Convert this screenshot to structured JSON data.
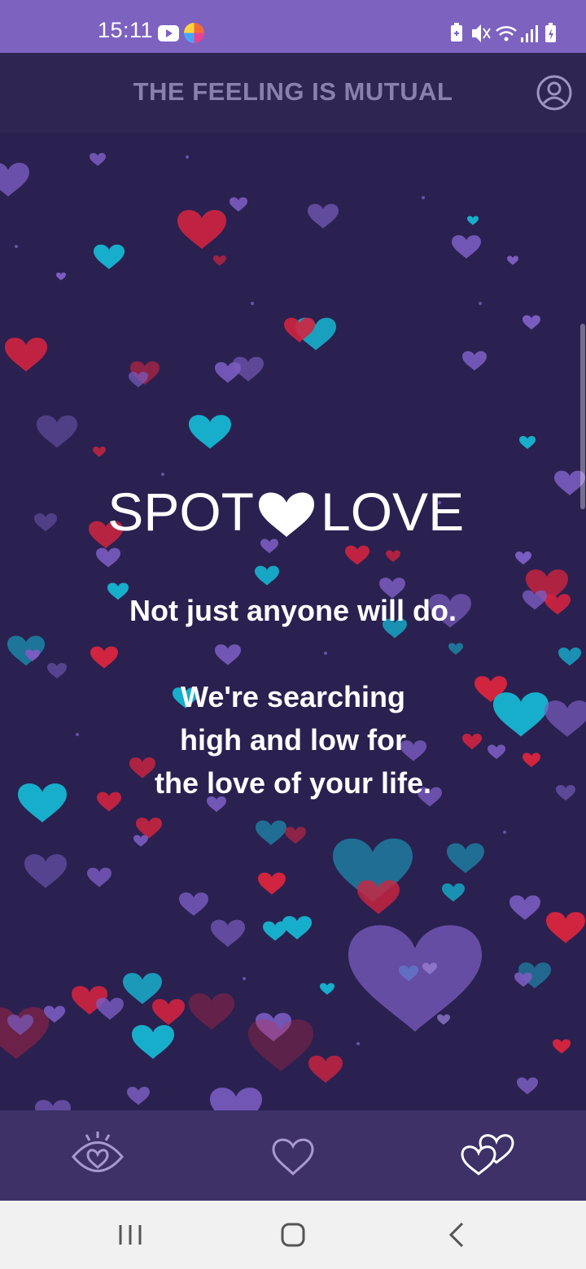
{
  "status_bar": {
    "time": "15:11",
    "icons": [
      "youtube-icon",
      "app-icon",
      "battery-saver-icon",
      "mute-icon",
      "wifi-icon",
      "signal-icon",
      "battery-charging-icon"
    ]
  },
  "header": {
    "title": "THE FEELING IS MUTUAL",
    "profile_icon": "profile-icon"
  },
  "main": {
    "logo_left": "SPOT",
    "logo_right": "LOVE",
    "tagline": {
      "line1": "Not just anyone will do.",
      "line2": "We're searching",
      "line3": "high and low for",
      "line4": "the love of your life."
    }
  },
  "bottom_nav": {
    "items": [
      {
        "icon": "eye-heart-icon",
        "active": false
      },
      {
        "icon": "heart-icon",
        "active": false
      },
      {
        "icon": "two-hearts-icon",
        "active": true
      }
    ]
  },
  "system_nav": {
    "buttons": [
      "recents-icon",
      "home-icon",
      "back-icon"
    ]
  },
  "colors": {
    "status_bar": "#7d62c0",
    "background": "#2a2150",
    "app_bar": "#2e2553",
    "bottom_nav": "#3d3168",
    "heart_red": "#d0243f",
    "heart_cyan": "#17aecb",
    "heart_purple": "#7a5cc0",
    "inactive_icon": "#a89ad0",
    "active_icon": "#ffffff"
  }
}
